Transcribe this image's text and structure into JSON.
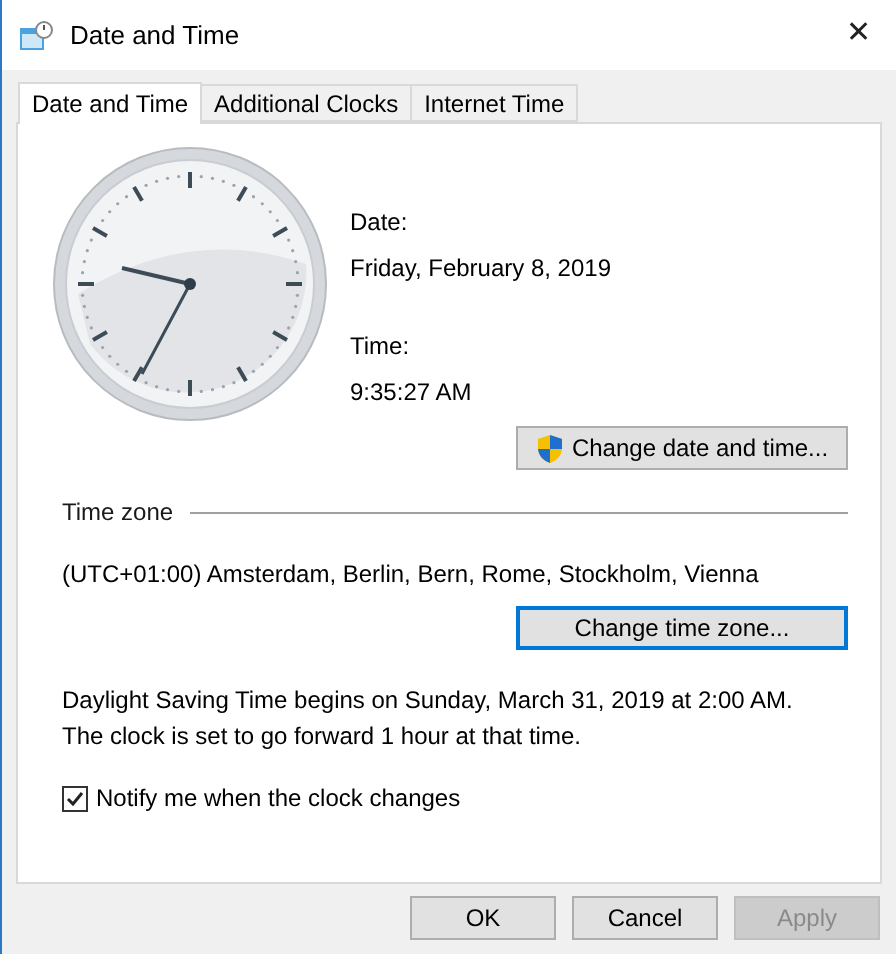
{
  "window": {
    "title": "Date and Time",
    "close": "✕"
  },
  "tabs": [
    {
      "label": "Date and Time",
      "selected": true
    },
    {
      "label": "Additional Clocks",
      "selected": false
    },
    {
      "label": "Internet Time",
      "selected": false
    }
  ],
  "date": {
    "label": "Date:",
    "value": "Friday, February 8, 2019"
  },
  "time": {
    "label": "Time:",
    "value": "9:35:27 AM"
  },
  "change_date_button": {
    "label": "Change date and time...",
    "focused": false
  },
  "time_zone": {
    "heading": "Time zone",
    "value": "(UTC+01:00) Amsterdam, Berlin, Bern, Rome, Stockholm, Vienna"
  },
  "change_zone_button": {
    "label": "Change time zone...",
    "focused": true
  },
  "dst_note": "Daylight Saving Time begins on Sunday, March 31, 2019 at 2:00 AM. The clock is set to go forward 1 hour at that time.",
  "notify": {
    "label": "Notify me when the clock changes",
    "checked": true
  },
  "buttons": [
    {
      "label": "OK",
      "disabled": false
    },
    {
      "label": "Cancel",
      "disabled": false
    },
    {
      "label": "Apply",
      "disabled": true
    }
  ]
}
